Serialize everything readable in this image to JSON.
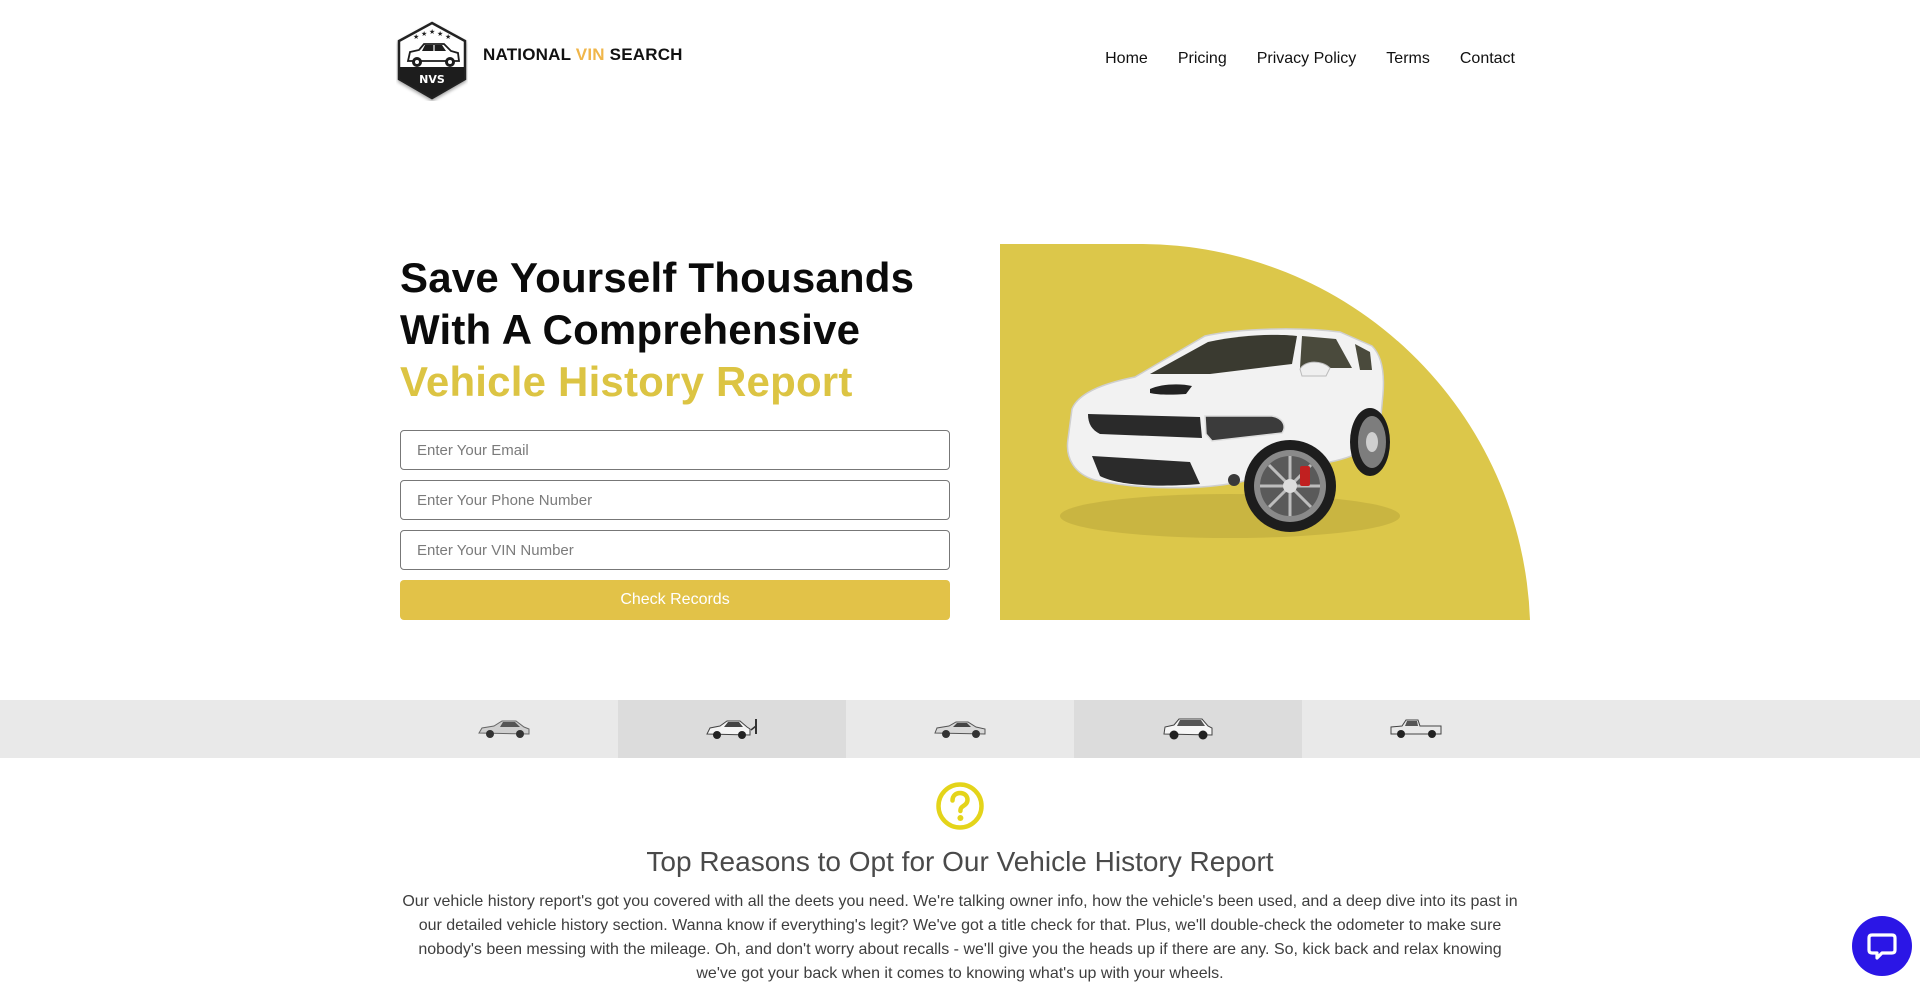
{
  "brand": {
    "badge_text": "NVS",
    "name_part1": "NATIONAL ",
    "name_accent": "VIN",
    "name_part2": " SEARCH",
    "accent_color": "#f0b64a"
  },
  "nav": {
    "items": [
      {
        "label": "Home"
      },
      {
        "label": "Pricing"
      },
      {
        "label": "Privacy Policy"
      },
      {
        "label": "Terms"
      },
      {
        "label": "Contact"
      }
    ]
  },
  "hero": {
    "title_line1": "Save Yourself Thousands",
    "title_line2": "With A Comprehensive",
    "title_accent": "Vehicle History Report",
    "accent_color": "#dcc443",
    "form": {
      "email_placeholder": "Enter Your Email",
      "email_value": "",
      "phone_placeholder": "Enter Your Phone Number",
      "phone_value": "",
      "vin_placeholder": "Enter Your VIN Number",
      "vin_value": "",
      "submit_label": "Check Records",
      "submit_color": "#e2c248"
    },
    "image": {
      "subject": "white sports sedan",
      "background_color": "#dcc74a"
    }
  },
  "vehicle_strip": {
    "items": [
      {
        "type": "sedan"
      },
      {
        "type": "electric-car"
      },
      {
        "type": "sports-coupe"
      },
      {
        "type": "suv"
      },
      {
        "type": "pickup-truck"
      }
    ]
  },
  "reasons": {
    "icon": "question-circle-icon",
    "icon_color": "#e4d41a",
    "title": "Top Reasons to Opt for Our Vehicle History Report",
    "body": "Our vehicle history report's got you covered with all the deets you need. We're talking owner info, how the vehicle's been used, and a deep dive into its past in our detailed vehicle history section. Wanna know if everything's legit? We've got a title check for that. Plus, we'll double-check the odometer to make sure nobody's been messing with the mileage. Oh, and don't worry about recalls - we'll give you the heads up if there are any. So, kick back and relax knowing we've got your back when it comes to knowing what's up with your wheels."
  },
  "chat": {
    "icon": "chat-bubble-icon",
    "color": "#2b16e6"
  }
}
